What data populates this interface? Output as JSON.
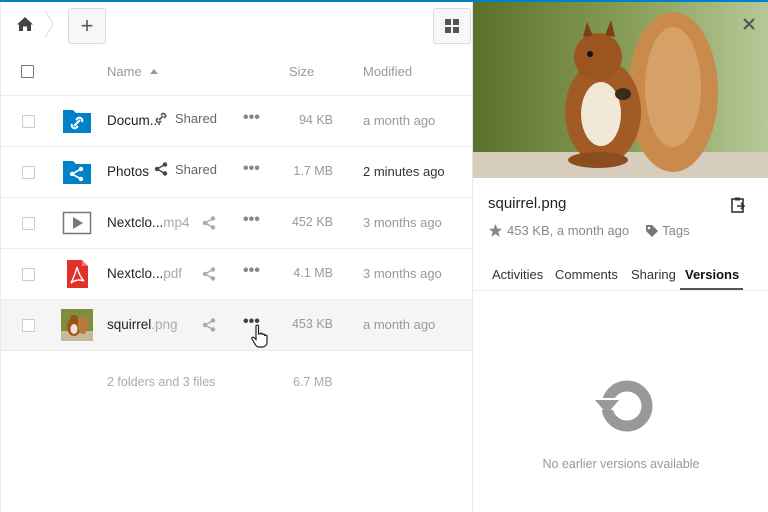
{
  "colors": {
    "accent": "#0082c9",
    "folder": "#0082c9",
    "pdf": "#e4302b",
    "muted": "#999999"
  },
  "toolbar": {
    "new_label": "+",
    "home_icon": "home-icon",
    "grid_icon": "grid-view-icon"
  },
  "columns": {
    "name": "Name",
    "size": "Size",
    "modified": "Modified"
  },
  "files": [
    {
      "name": "Docum...",
      "ext": "",
      "type": "folder-link",
      "shared": true,
      "share_label": "Shared",
      "size": "94 KB",
      "modified": "a month ago"
    },
    {
      "name": "Photos",
      "ext": "",
      "type": "folder-shared",
      "shared": true,
      "share_label": "Shared",
      "size": "1.7 MB",
      "modified": "2 minutes ago"
    },
    {
      "name": "Nextclo...",
      "ext": "mp4",
      "type": "video",
      "shared": false,
      "size": "452 KB",
      "modified": "3 months ago"
    },
    {
      "name": "Nextclo...",
      "ext": "pdf",
      "type": "pdf",
      "shared": false,
      "size": "4.1 MB",
      "modified": "3 months ago"
    },
    {
      "name": "squirrel",
      "ext": ".png",
      "type": "image",
      "shared": false,
      "size": "453 KB",
      "modified": "a month ago"
    }
  ],
  "summary": {
    "text": "2 folders and 3 files",
    "size": "6.7 MB"
  },
  "sidebar": {
    "filename": "squirrel.png",
    "meta": "453 KB, a month ago",
    "tags_label": "Tags",
    "tabs": [
      "Activities",
      "Comments",
      "Sharing",
      "Versions"
    ],
    "active_tab": "Versions",
    "empty_message": "No earlier versions available"
  }
}
